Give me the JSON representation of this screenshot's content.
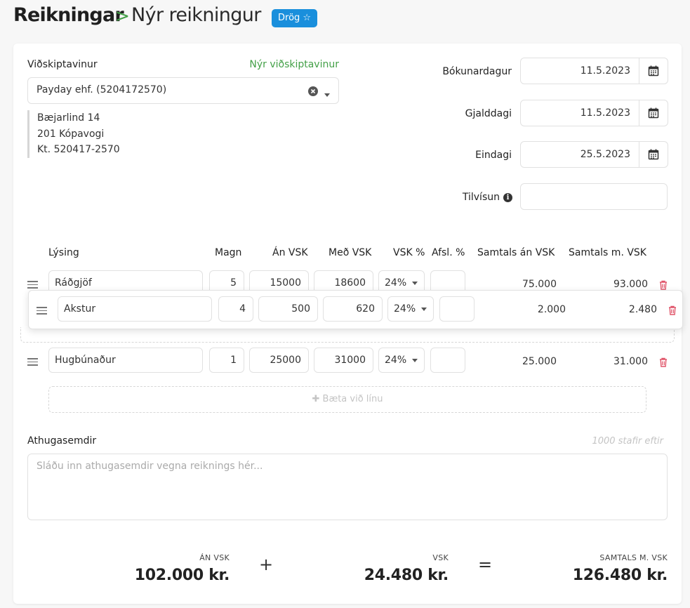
{
  "header": {
    "breadcrumb_root": "Reikningar",
    "separator": ">",
    "page_title": "Nýr reikningur",
    "status_badge": "Drög ☆"
  },
  "customer": {
    "label": "Viðskiptavinur",
    "new_customer_link": "Nýr viðskiptavinur",
    "selected": "Payday ehf. (5204172570)",
    "address_line1": "Bæjarlind 14",
    "address_line2": "201 Kópavogi",
    "kennitala": "Kt. 520417-2570"
  },
  "dates": {
    "booking_label": "Bókunardagur",
    "booking_value": "11.5.2023",
    "billing_label": "Gjalddagi",
    "billing_value": "11.5.2023",
    "due_label": "Eindagi",
    "due_value": "25.5.2023",
    "reference_label": "Tilvísun",
    "reference_value": ""
  },
  "table": {
    "headers": {
      "description": "Lýsing",
      "quantity": "Magn",
      "price_ex_vat": "Án VSK",
      "price_inc_vat": "Með VSK",
      "vat_pct": "VSK %",
      "discount_pct": "Afsl. %",
      "total_ex_vat": "Samtals án VSK",
      "total_inc_vat": "Samtals m. VSK"
    },
    "rows": [
      {
        "description": "Ráðgjöf",
        "quantity": "5",
        "price_ex_vat": "15000",
        "price_inc_vat": "18600",
        "vat_pct": "24%",
        "discount_pct": "",
        "total_ex_vat": "75.000",
        "total_inc_vat": "93.000"
      },
      {
        "description": "Akstur",
        "quantity": "4",
        "price_ex_vat": "500",
        "price_inc_vat": "620",
        "vat_pct": "24%",
        "discount_pct": "",
        "total_ex_vat": "2.000",
        "total_inc_vat": "2.480"
      },
      {
        "description": "Hugbúnaður",
        "quantity": "1",
        "price_ex_vat": "25000",
        "price_inc_vat": "31000",
        "vat_pct": "24%",
        "discount_pct": "",
        "total_ex_vat": "25.000",
        "total_inc_vat": "31.000"
      }
    ],
    "add_line_label": "✚ Bæta við línu"
  },
  "notes": {
    "label": "Athugasemdir",
    "chars_left": "1000 stafir eftir",
    "placeholder": "Sláðu inn athugasemdir vegna reiknings hér..."
  },
  "summary": {
    "ex_vat_label": "ÁN VSK",
    "ex_vat_value": "102.000 kr.",
    "plus": "+",
    "vat_label": "VSK",
    "vat_value": "24.480 kr.",
    "equals": "=",
    "total_label": "SAMTALS M. VSK",
    "total_value": "126.480 kr."
  },
  "colors": {
    "accent_green": "#43a047",
    "badge_blue": "#1a8fdc",
    "delete_red": "#e0556a"
  }
}
